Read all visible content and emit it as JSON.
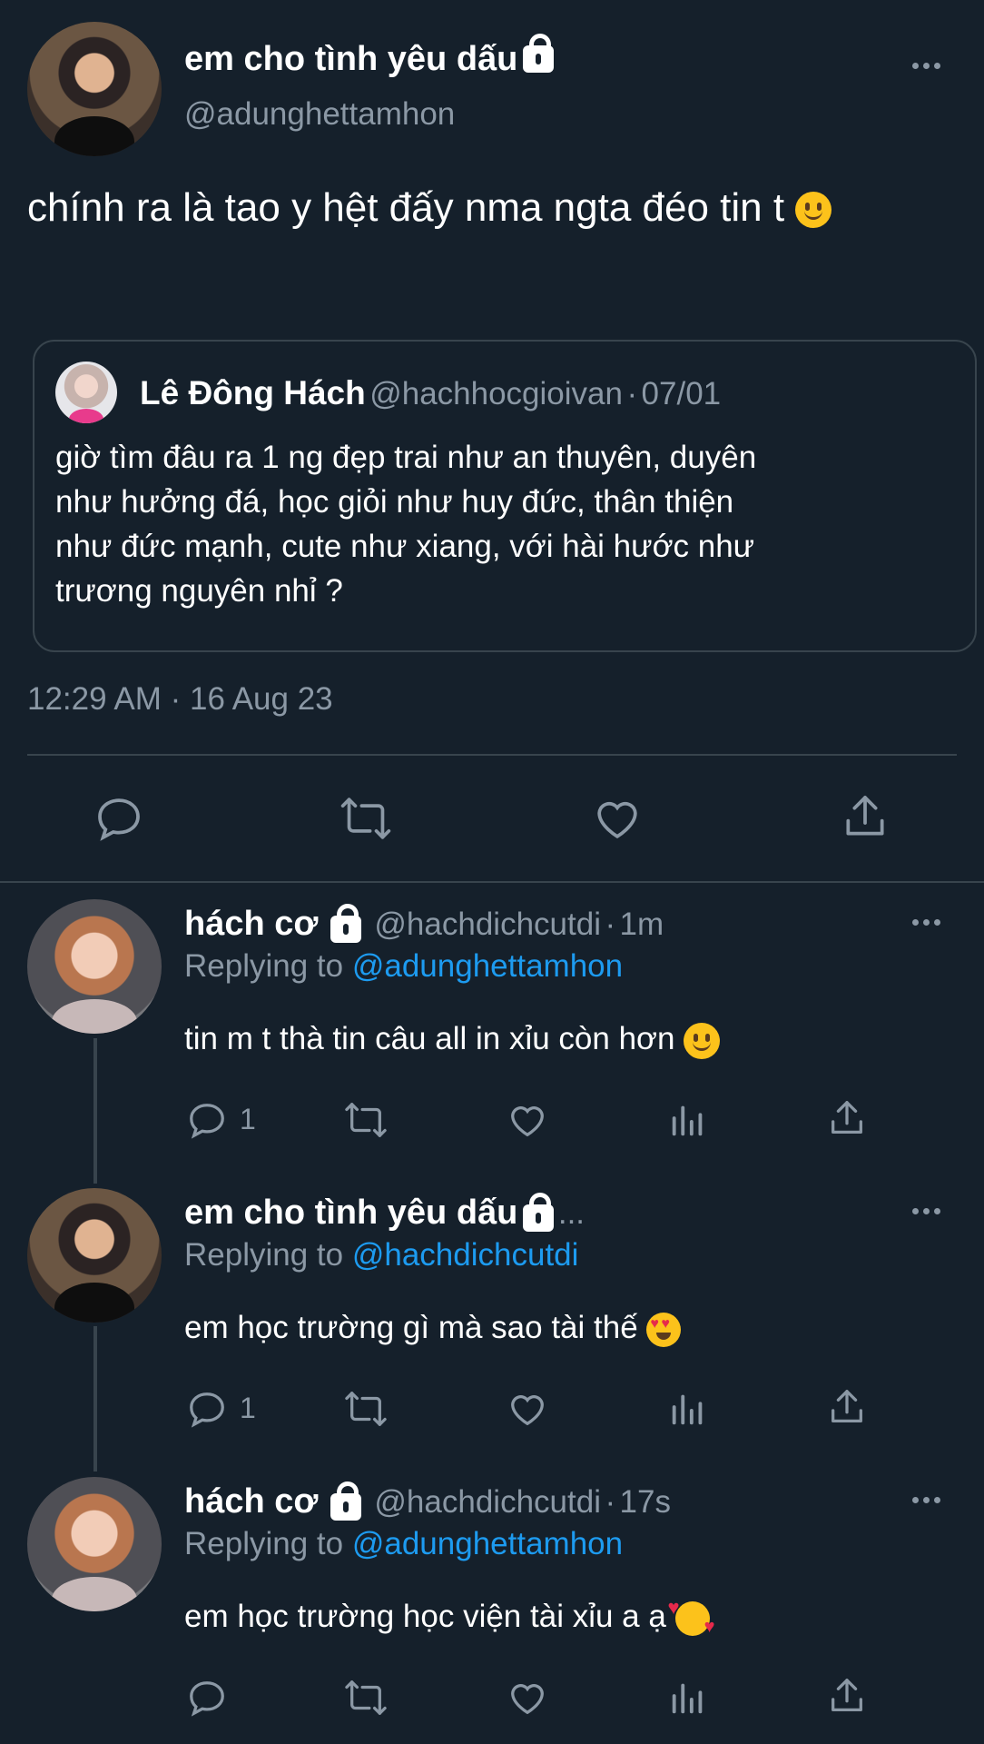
{
  "main_tweet": {
    "author_name": "em cho tình yêu dấu",
    "author_handle": "@adunghettamhon",
    "text": "chính ra là tao y hệt đấy nma ngta đéo tin t",
    "timestamp": "12:29 AM · 16 Aug 23",
    "quoted": {
      "author_name": "Lê Đông Hách",
      "author_handle": "@hachhocgioivan",
      "date": "07/01",
      "text": "giờ tìm đâu ra 1 ng đẹp trai như an thuyên, duyên như hưởng đá, học giỏi như huy đức, thân thiện như đức mạnh, cute như xiang, với hài hước như trương nguyên nhỉ ?"
    }
  },
  "replies": [
    {
      "author_name": "hách cơ",
      "author_handle": "@hachdichcutdi",
      "age": "1m",
      "replying_label": "Replying to",
      "replying_to": "@adunghettamhon",
      "text": "tin m t thà tin câu all in xỉu còn hơn",
      "reply_count": "1"
    },
    {
      "author_name": "em cho tình yêu dấu",
      "ellipsis": "...",
      "replying_label": "Replying to",
      "replying_to": "@hachdichcutdi",
      "text": "em học trường gì mà sao tài thế",
      "reply_count": "1"
    },
    {
      "author_name": "hách cơ",
      "author_handle": "@hachdichcutdi",
      "age": "17s",
      "replying_label": "Replying to",
      "replying_to": "@adunghettamhon",
      "text": "em học trường học viện tài xỉu a ạ"
    }
  ],
  "colors": {
    "background": "#15202b",
    "muted": "#8b98a5",
    "link": "#1d9bf0",
    "divider": "#38444d"
  }
}
